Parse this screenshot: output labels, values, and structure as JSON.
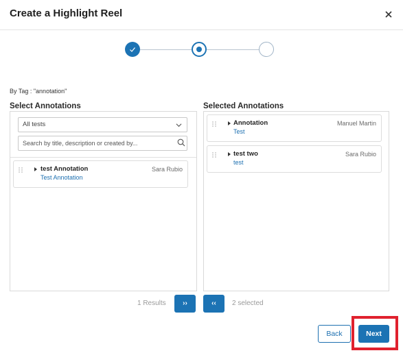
{
  "dialog": {
    "title": "Create a Highlight Reel"
  },
  "filter": {
    "tag_line": "By Tag : \"annotation\""
  },
  "left": {
    "heading": "Select Annotations",
    "select_value": "All tests",
    "search_placeholder": "Search by title, description or created by...",
    "items": [
      {
        "title": "test Annotation",
        "subtitle": "Test Annotation",
        "author": "Sara Rubio"
      }
    ]
  },
  "right": {
    "heading": "Selected Annotations",
    "items": [
      {
        "title": "Annotation",
        "subtitle": "Test",
        "author": "Manuel Martin"
      },
      {
        "title": "test two",
        "subtitle": "test",
        "author": "Sara Rubio"
      }
    ]
  },
  "footer": {
    "results": "1 Results",
    "add_label": "››",
    "remove_label": "‹‹",
    "selected": "2 selected",
    "back_label": "Back",
    "next_label": "Next"
  },
  "stepper": {
    "current_step": 2,
    "total_steps": 3
  },
  "colors": {
    "accent": "#1c73b4",
    "highlight": "#e0212e"
  },
  "icons": [
    "close-icon",
    "check-icon",
    "chevron-down-icon",
    "search-icon",
    "drag-handle-icon",
    "caret-right-icon"
  ]
}
